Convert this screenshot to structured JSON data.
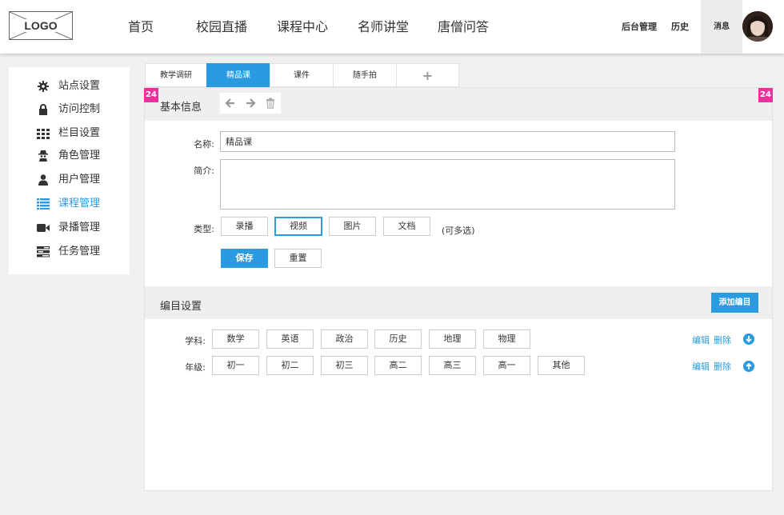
{
  "header": {
    "logo_text": "LOGO",
    "nav": [
      "首页",
      "校园直播",
      "课程中心",
      "名师讲堂",
      "唐僧问答"
    ],
    "admin": "后台管理",
    "history": "历史",
    "messages": "消息"
  },
  "sidebar": {
    "active": "课程管理",
    "items": [
      {
        "label": "站点设置",
        "icon": "gear-icon"
      },
      {
        "label": "访问控制",
        "icon": "lock-icon"
      },
      {
        "label": "栏目设置",
        "icon": "grid-icon"
      },
      {
        "label": "角色管理",
        "icon": "spy-icon"
      },
      {
        "label": "用户管理",
        "icon": "user-icon"
      },
      {
        "label": "课程管理",
        "icon": "list-icon"
      },
      {
        "label": "录播管理",
        "icon": "video-camera-icon"
      },
      {
        "label": "任务管理",
        "icon": "tasks-icon"
      }
    ]
  },
  "tabs": {
    "items": [
      "教学调研",
      "精品课",
      "课件",
      "随手拍"
    ],
    "active": "精品课",
    "add_label": "+"
  },
  "basic": {
    "title": "基本信息",
    "badge": "24",
    "name_label": "名称:",
    "name_value": "精品课",
    "intro_label": "简介:",
    "intro_value": "",
    "type_label": "类型:",
    "types": [
      "录播",
      "视频",
      "图片",
      "文档"
    ],
    "selected_type": "视频",
    "multi_hint": "(可多选)",
    "save": "保存",
    "reset": "重置"
  },
  "catalog": {
    "title": "编目设置",
    "add": "添加编目",
    "rows": [
      {
        "label": "学科:",
        "items": [
          "数学",
          "英语",
          "政治",
          "历史",
          "地理",
          "物理"
        ],
        "edit": "编辑",
        "delete": "删除",
        "icon": "arrow-down-circle-icon"
      },
      {
        "label": "年级:",
        "items": [
          "初一",
          "初二",
          "初三",
          "高二",
          "高三",
          "高一",
          "其他"
        ],
        "edit": "编辑",
        "delete": "删除",
        "icon": "arrow-up-circle-icon"
      }
    ]
  },
  "colors": {
    "accent": "#2a9be0",
    "badge": "#e8329c"
  }
}
